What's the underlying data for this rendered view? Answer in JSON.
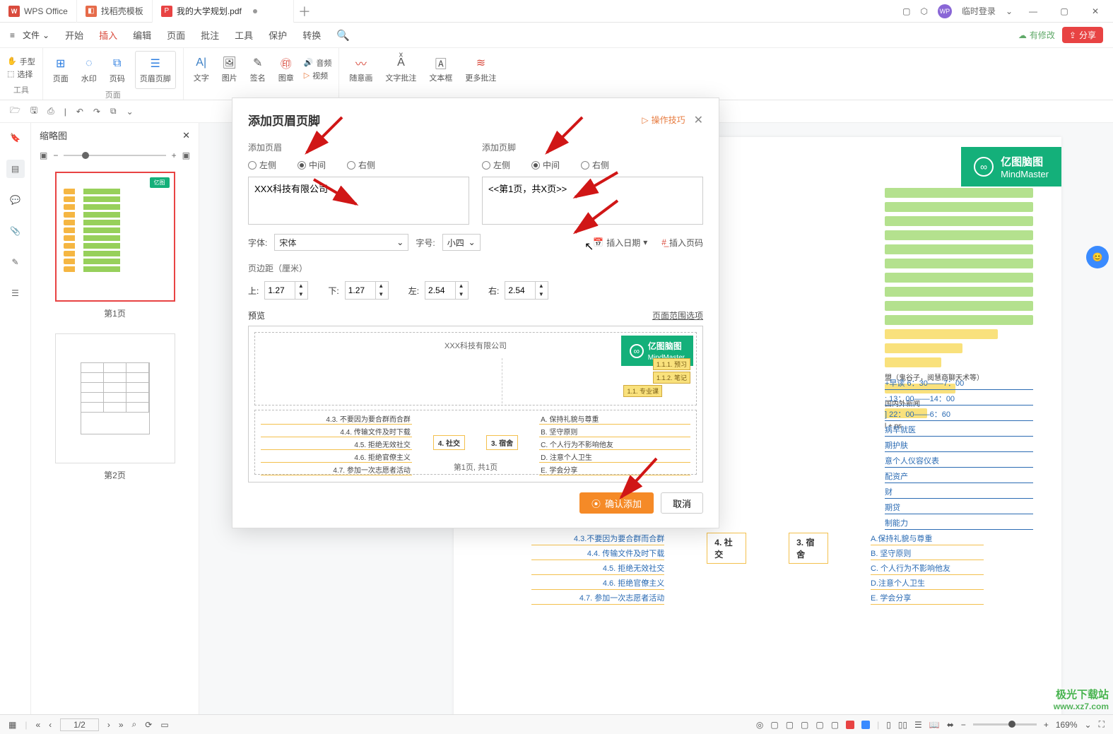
{
  "titlebar": {
    "tab_wps": "WPS Office",
    "tab_templates": "找稻壳模板",
    "tab_pdf": "我的大学规划.pdf",
    "login": "临时登录"
  },
  "menubar": {
    "file": "文件",
    "items": [
      "开始",
      "插入",
      "编辑",
      "页面",
      "批注",
      "工具",
      "保护",
      "转换"
    ],
    "modified": "有修改",
    "share": "分享"
  },
  "ribbon": {
    "g1a": "手型",
    "g1b": "选择",
    "g1c": "工具",
    "g2a": "页面",
    "g2b": "水印",
    "g2c": "页码",
    "g2d": "页眉页脚",
    "g2l": "页面",
    "g3a": "文字",
    "g3b": "图片",
    "g3c": "签名",
    "g3d": "图章",
    "g3e": "音频",
    "g3f": "视频",
    "g4a": "随意画",
    "g4b": "文字批注",
    "g4c": "文本框",
    "g4d": "更多批注"
  },
  "quickbar": {},
  "thumbnails": {
    "title": "缩略图",
    "p1": "第1页",
    "p2": "第2页"
  },
  "dialog": {
    "title": "添加页眉页脚",
    "tips": "操作技巧",
    "header_label": "添加页眉",
    "footer_label": "添加页脚",
    "pos_left": "左侧",
    "pos_center": "中间",
    "pos_right": "右侧",
    "header_text": "XXX科技有限公司",
    "footer_text": "<<第1页，共X页>>",
    "font_label": "字体:",
    "font_value": "宋体",
    "size_label": "字号:",
    "size_value": "小四",
    "insert_date": "插入日期",
    "insert_pageno": "插入页码",
    "margin_label": "页边距（厘米）",
    "m_top": "上:",
    "m_bottom": "下:",
    "m_left": "左:",
    "m_right": "右:",
    "m_top_v": "1.27",
    "m_bottom_v": "1.27",
    "m_left_v": "2.54",
    "m_right_v": "2.54",
    "preview_label": "预览",
    "preview_link": "页面范围选项",
    "pv_header": "XXX科技有限公司",
    "pv_footer": "第1页, 共1页",
    "pv_brand1": "亿图脑图",
    "pv_brand2": "MindMaster",
    "pv_tag1": "1.1.1. 预习",
    "pv_tag2": "1.1.2. 笔记",
    "pv_tag3": "1.1. 专业课",
    "pv_s4": "4. 社交",
    "pv_s3": "3. 宿舍",
    "pv_41": "4.3. 不要因为要合群而合群",
    "pv_42": "4.4. 传输文件及时下载",
    "pv_43": "4.5. 拒绝无效社交",
    "pv_44": "4.6. 拒绝官僚主义",
    "pv_45": "4.7. 参加一次志愿者活动",
    "pv_3a": "A. 保持礼貌与尊重",
    "pv_3b": "B. 坚守原则",
    "pv_3c": "C. 个人行为不影响他友",
    "pv_3d": "D. 注意个人卫生",
    "pv_3e": "E. 学会分享",
    "confirm": "确认添加",
    "cancel": "取消"
  },
  "doc": {
    "brand1": "亿图脑图",
    "brand2": "MindMaster",
    "tag_top": "盟（鬼谷子，阅慧商聊天术等）",
    "tag_news": "国内外新闻",
    "tag_ps": "l + ps",
    "rt1": "+早读 6：30——7：00",
    "rt2": ": 13：00——14：00",
    "rt3": "] 22：00——6：60",
    "rt4": "病早就医",
    "rt5": "期护肤",
    "rt6": "意个人仪容仪表",
    "rt7": "配资产",
    "rt8": "财",
    "rt9": "期贷",
    "rt10": "制能力",
    "n4": "4. 社交",
    "n3": "3. 宿舍",
    "l41": "4.3.不要因为要合群而合群",
    "l42": "4.4. 传输文件及时下载",
    "l43": "4.5. 拒绝无效社交",
    "l44": "4.6. 拒绝官僚主义",
    "l45": "4.7. 参加一次志愿者活动",
    "r3a": "A.保持礼貌与尊重",
    "r3b": "B. 坚守原则",
    "r3c": "C. 个人行为不影响他友",
    "r3d": "D.注意个人卫生",
    "r3e": "E. 学会分享"
  },
  "status": {
    "page": "1/2",
    "zoom": "169%"
  },
  "watermark": {
    "l1": "极光下载站",
    "l2": "www.xz7.com"
  }
}
